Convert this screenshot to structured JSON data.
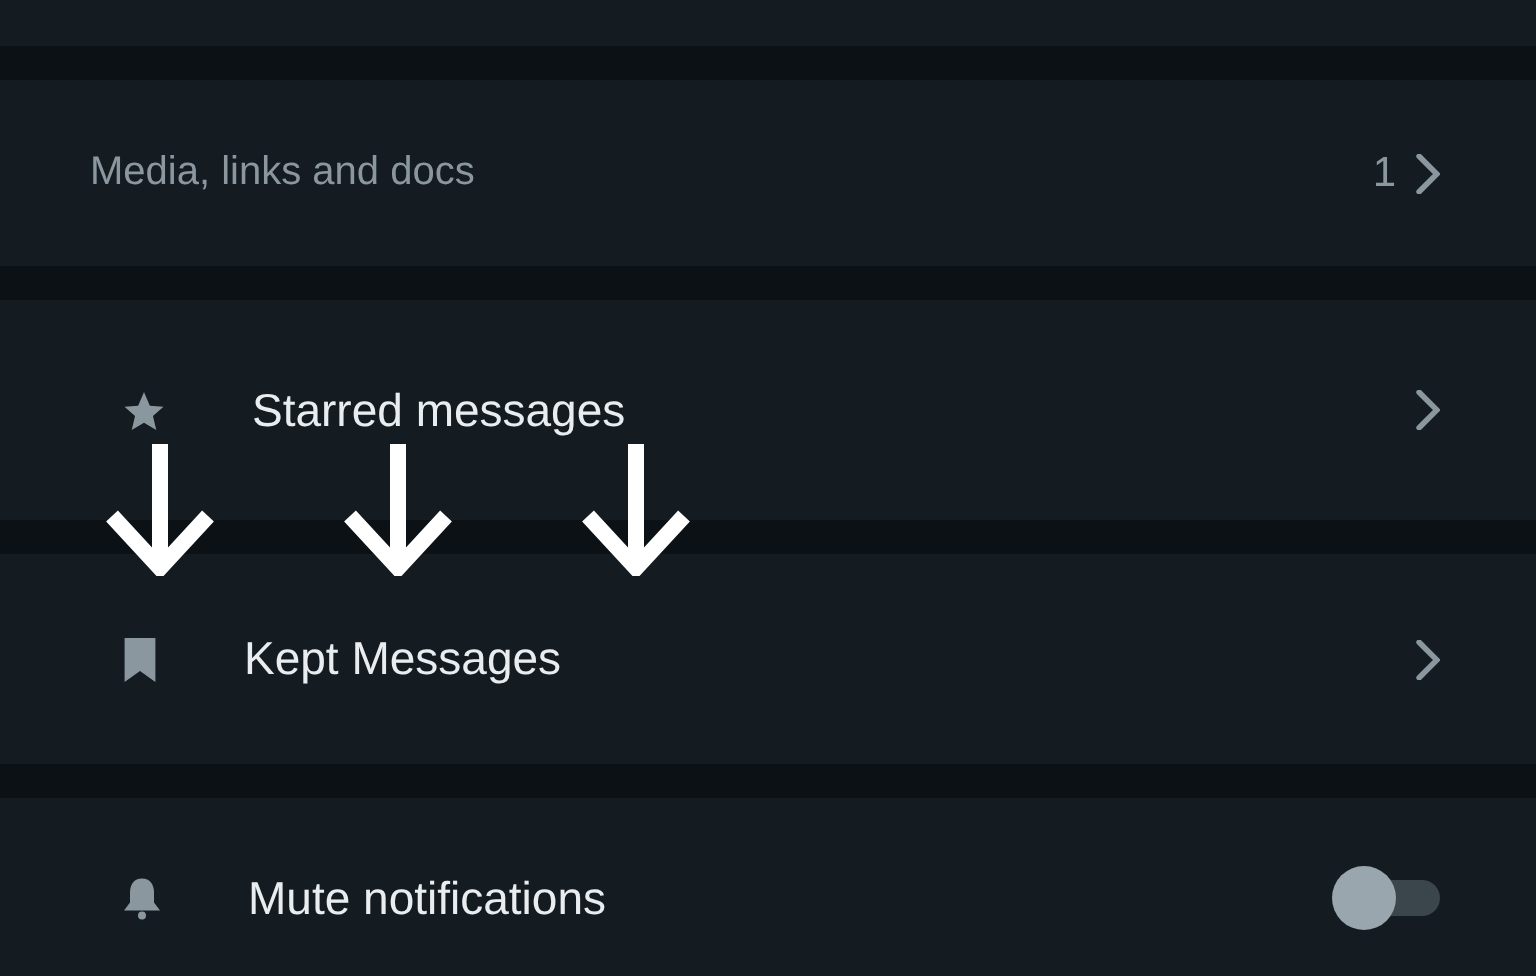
{
  "sections": [
    {
      "rows": [
        {
          "kind": "media",
          "label": "Media, links and docs",
          "count": "1"
        }
      ]
    },
    {
      "rows": [
        {
          "kind": "starred",
          "label": "Starred messages"
        }
      ]
    },
    {
      "rows": [
        {
          "kind": "kept",
          "label": "Kept Messages"
        }
      ]
    },
    {
      "rows": [
        {
          "kind": "mute",
          "label": "Mute notifications",
          "on": false
        }
      ]
    }
  ]
}
